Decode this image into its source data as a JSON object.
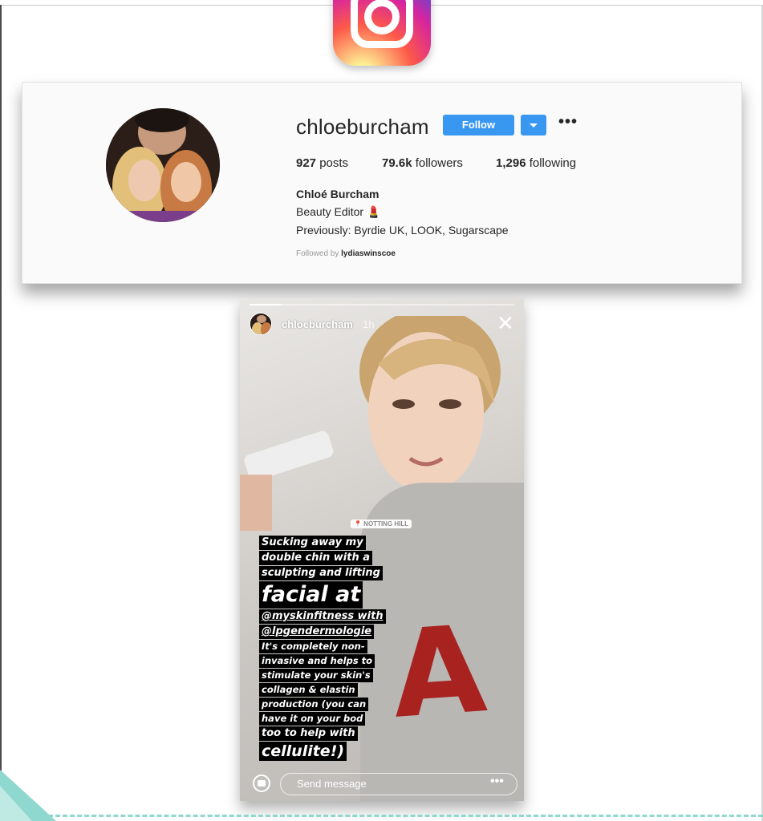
{
  "profile": {
    "username": "chloeburcham",
    "follow_label": "Follow",
    "more_label": "•••",
    "stats": {
      "posts_count": "927",
      "posts_label": "posts",
      "followers_count": "79.6k",
      "followers_label": "followers",
      "following_count": "1,296",
      "following_label": "following"
    },
    "full_name": "Chloé Burcham",
    "bio_line1": "Beauty Editor 💄",
    "bio_line2": "Previously: Byrdie UK, LOOK, Sugarscape",
    "followed_by_prefix": "Followed by",
    "followed_by_user": "lydiaswinscoe"
  },
  "story": {
    "username": "chloeburcham",
    "time": "1h",
    "close_label": "✕",
    "location": "📍 NOTTING HILL",
    "caption": {
      "l1": "Sucking away my",
      "l2": "double chin with a",
      "l3": "sculpting and lifting",
      "l4": "facial at",
      "l5": "@myskinfitness with",
      "l6": "@lpgendermologie",
      "l7": "It's completely non-",
      "l8": "invasive and helps to",
      "l9": "stimulate your skin's",
      "l10": "collagen & elastin",
      "l11": "production (you can",
      "l12": "have it on your bod",
      "l13": "too to help with",
      "l14": "cellulite!)"
    },
    "message_placeholder": "Send message",
    "more_label": "•••"
  },
  "colors": {
    "follow_blue": "#3897f0",
    "sweater_red": "#a82320",
    "teal_accent": "#8fd8cf"
  }
}
